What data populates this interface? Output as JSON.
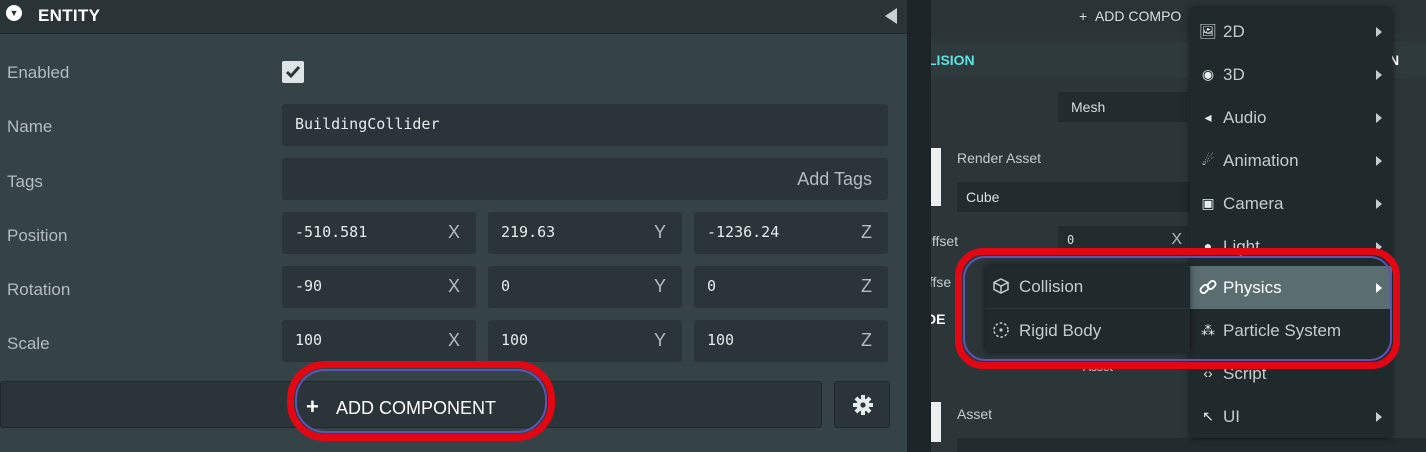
{
  "entity_panel": {
    "title": "ENTITY",
    "enabled_label": "Enabled",
    "enabled": true,
    "name_label": "Name",
    "name_value": "BuildingCollider",
    "tags_label": "Tags",
    "tags_placeholder": "Add Tags",
    "position": {
      "label": "Position",
      "x": "-510.581",
      "y": "219.63",
      "z": "-1236.24"
    },
    "rotation": {
      "label": "Rotation",
      "x": "-90",
      "y": "0",
      "z": "0"
    },
    "scale": {
      "label": "Scale",
      "x": "100",
      "y": "100",
      "z": "100"
    },
    "axis_labels": {
      "x": "X",
      "y": "Y",
      "z": "Z"
    },
    "add_component_label": "ADD COMPONENT",
    "add_component_plus": "+"
  },
  "right_panel": {
    "add_component_label": "ADD COMPO",
    "add_component_plus": "+",
    "collision_header_left": "LISION",
    "collision_header_right": "N",
    "type_value": "Mesh",
    "render_asset_label": "Render Asset",
    "render_asset_value": "Cube",
    "offset_label": "Offset",
    "offset_value": "0",
    "offset_axis": "X",
    "offset2_label": "Offse",
    "section_label": "DE",
    "asset_value": "Asset",
    "asset_label": "Asset"
  },
  "component_menu": [
    {
      "label": "2D",
      "icon": "image-icon",
      "submenu": true
    },
    {
      "label": "3D",
      "icon": "cube-icon",
      "submenu": true
    },
    {
      "label": "Audio",
      "icon": "speaker-icon",
      "submenu": true
    },
    {
      "label": "Animation",
      "icon": "running-icon",
      "submenu": true
    },
    {
      "label": "Camera",
      "icon": "camera-icon",
      "submenu": true
    },
    {
      "label": "Light",
      "icon": "bulb-icon",
      "submenu": true
    },
    {
      "label": "Physics",
      "icon": "link-icon",
      "submenu": true,
      "active": true
    },
    {
      "label": "Particle System",
      "icon": "particles-icon",
      "submenu": false
    },
    {
      "label": "Script",
      "icon": "code-icon",
      "submenu": false
    },
    {
      "label": "UI",
      "icon": "cursor-icon",
      "submenu": true
    }
  ],
  "physics_submenu": [
    {
      "label": "Collision",
      "icon": "collision-cube-icon"
    },
    {
      "label": "Rigid Body",
      "icon": "rigid-body-icon"
    }
  ],
  "colors": {
    "panel": "#364346",
    "field": "#2b3539",
    "menu_active": "#5a6d71",
    "highlight_ring": "#e30613",
    "accent_cyan": "#5fe3e1"
  }
}
